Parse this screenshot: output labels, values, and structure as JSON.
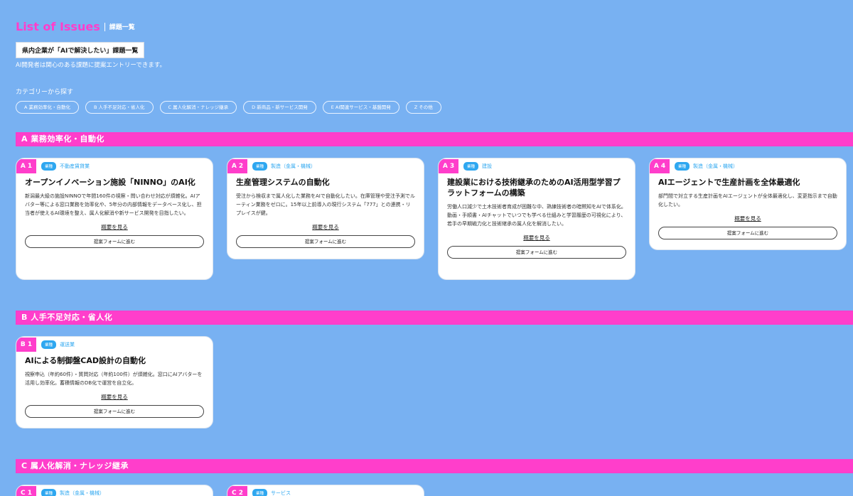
{
  "header": {
    "title_en": "List of Issues",
    "title_ja": "課題一覧",
    "subtitle": "県内企業が「AIで解決したい」課題一覧",
    "lead": "AI開発者は関心のある課題に提案エントリーできます。"
  },
  "categories": {
    "label": "カテゴリーから探す",
    "pills": [
      "A 業務効率化・自動化",
      "B 人手不足対応・省人化",
      "C 属人化解消・ナレッジ継承",
      "D 新商品・新サービス開発",
      "E AI関連サービス・基盤開発",
      "Z その他"
    ]
  },
  "sections": {
    "a": {
      "label": "A 業務効率化・自動化"
    },
    "b": {
      "label": "B 人手不足対応・省人化"
    },
    "c": {
      "label": "C 属人化解消・ナレッジ継承"
    }
  },
  "card_common": {
    "tag": "業種",
    "summary_link": "概要を見る",
    "form_button": "提案フォームに進む"
  },
  "cards": {
    "a1": {
      "code": "A 1",
      "industry": "不動産賃貸業",
      "title": "オープンイノベーション施設「NINNO」のAI化",
      "desc": "新潟最大級の施設NINNOで年間160件の視察・問い合わせ対応が煩雑化。AIアバター等による窓口業務を効率化や、5年分の内部情報をデータベース化し、担当者が使えるAI環境を整え、属人化解消や新サービス開発を目指したい。"
    },
    "a2": {
      "code": "A 2",
      "industry": "製造（金属・機械）",
      "title": "生産管理システムの自動化",
      "desc": "受注から検収まで属人化した業務をAIで自動化したい。在庫管理や受注予測でルーティン業務をゼロに。15年以上前導入の現行システム「777」との連携・リプレイスが鍵。"
    },
    "a3": {
      "code": "A 3",
      "industry": "建設",
      "title": "建設業における技術継承のためのAI活用型学習プラットフォームの構築",
      "desc": "労働人口減少で土木技術者育成が困難な中、熟練技術者の暗黙知をAIで体系化。動画・手順書・AIチャットでいつでも学べる仕組みと学習履歴の可視化により、若手の早期戦力化と技術継承の属人化を解消したい。"
    },
    "a4": {
      "code": "A 4",
      "industry": "製造（金属・機械）",
      "title": "AIエージェントで生産計画を全体最適化",
      "desc": "部門間で対立する生産計画をAIエージェントが全体最適化し、変更指示まで自動化したい。"
    },
    "b1": {
      "code": "B 1",
      "industry": "運送業",
      "title": "AIによる制御盤CAD設計の自動化",
      "desc": "視察申込（年約60件）・質問対応（年約100件）が煩雑化。窓口にAIアバターを活用し効率化。蓄積情報のDB化で運営を自立化。"
    },
    "c1": {
      "code": "C 1",
      "industry": "製造（金属・機械）"
    },
    "c2": {
      "code": "C 2",
      "industry": "サービス"
    }
  }
}
